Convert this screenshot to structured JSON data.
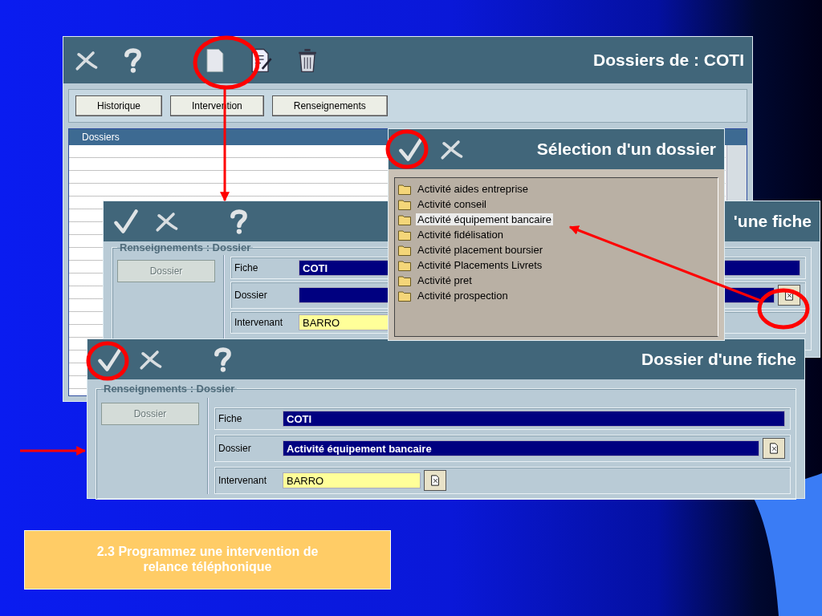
{
  "main_window": {
    "title": "Dossiers de : COTI",
    "tabs": [
      "Historique",
      "Intervention",
      "Renseignements"
    ],
    "list": {
      "column": "Dossiers"
    }
  },
  "form_windows": [
    {
      "title": "'une fiche",
      "group": "Renseignements : Dossier",
      "button": {
        "label": "Dossier",
        "disabled": true
      },
      "fields": [
        {
          "label": "Fiche",
          "value": "COTI",
          "kind": "readonly",
          "picker": false
        },
        {
          "label": "Dossier",
          "kind": "readonly",
          "picker": true
        },
        {
          "label": "Intervenant",
          "value": "BARRO",
          "kind": "editable",
          "picker": false
        }
      ]
    },
    {
      "title": "Dossier d'une fiche",
      "group": "Renseignements : Dossier",
      "button": {
        "label": "Dossier",
        "disabled": true
      },
      "fields": [
        {
          "label": "Fiche",
          "value": "COTI",
          "kind": "readonly",
          "picker": false
        },
        {
          "label": "Dossier",
          "value": "Activité équipement bancaire",
          "kind": "readonly",
          "picker": true
        },
        {
          "label": "Intervenant",
          "value": "BARRO",
          "kind": "editable",
          "picker": true
        }
      ]
    }
  ],
  "selection_window": {
    "title": "Sélection d'un dossier",
    "items": [
      {
        "label": "Activité aides entreprise",
        "selected": false
      },
      {
        "label": "Activité conseil",
        "selected": false
      },
      {
        "label": "Activité équipement bancaire",
        "selected": true
      },
      {
        "label": "Activité fidélisation",
        "selected": false
      },
      {
        "label": "Activité placement boursier",
        "selected": false
      },
      {
        "label": "Activité Placements Livrets",
        "selected": false
      },
      {
        "label": "Activité pret",
        "selected": false
      },
      {
        "label": "Activité prospection",
        "selected": false
      }
    ]
  },
  "caption": "2.3 Programmez une intervention de relance téléphonique"
}
